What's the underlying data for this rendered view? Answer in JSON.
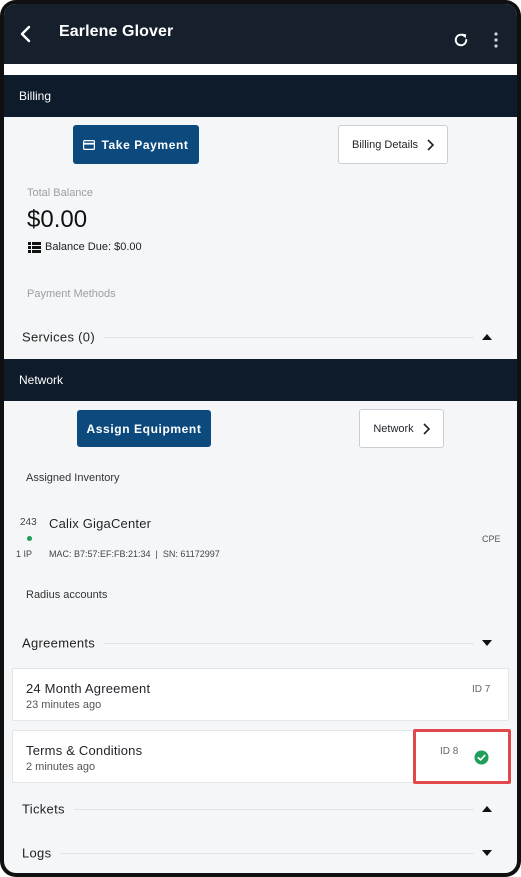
{
  "header": {
    "title": "Earlene Glover",
    "icons": {
      "back": "chevron-left-icon",
      "refresh": "refresh-icon",
      "more": "more-vertical-icon"
    }
  },
  "billing": {
    "section_title": "Billing",
    "take_payment_label": "Take Payment",
    "billing_details_label": "Billing Details",
    "total_balance_label": "Total Balance",
    "total_balance_value": "$0.00",
    "balance_due_text": "Balance Due: $0.00",
    "payment_methods_label": "Payment Methods",
    "services_label": "Services (0)"
  },
  "network": {
    "section_title": "Network",
    "assign_equipment_label": "Assign Equipment",
    "network_label": "Network",
    "assigned_inventory_label": "Assigned Inventory",
    "equipment": {
      "number": "243",
      "ip_count": "1 IP",
      "name": "Calix GigaCenter",
      "details": "MAC: B7:57:EF:FB:21:34  |  SN: 61172997",
      "type": "CPE",
      "status_color": "#1e9e5a"
    },
    "radius_label": "Radius accounts"
  },
  "agreements": {
    "label": "Agreements",
    "items": [
      {
        "name": "24 Month Agreement",
        "time": "23 minutes ago",
        "id": "ID 7"
      },
      {
        "name": "Terms & Conditions",
        "time": "2 minutes ago",
        "id": "ID 8"
      }
    ]
  },
  "tickets_label": "Tickets",
  "logs_label": "Logs",
  "colors": {
    "header_bg": "#16202c",
    "section_bg": "#0d1b2a",
    "primary_button": "#0c4a7e",
    "highlight": "#e0484c",
    "success": "#1e9e5a"
  }
}
